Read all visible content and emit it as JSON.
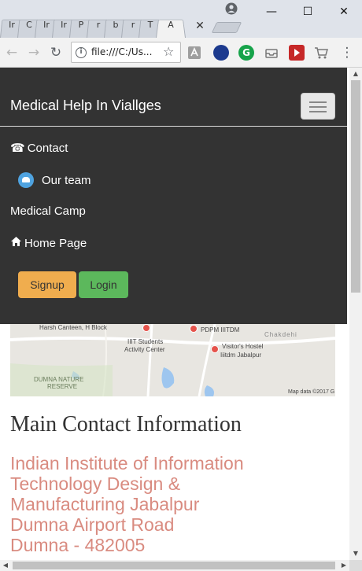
{
  "browser": {
    "tabs": [
      "Ir",
      "C",
      "Ir",
      "Ir",
      "P",
      "r",
      "b",
      "r",
      "T",
      "A"
    ],
    "url": "file:///C:/Us...",
    "window_controls": {
      "minimize": "—",
      "maximize": "☐",
      "close": "✕"
    },
    "extension_g_label": "G",
    "colors": {
      "titlebar": "#dfe3ea",
      "toolbar": "#f2f2f2"
    }
  },
  "navbar": {
    "brand": "Medical Help In Viallges",
    "items": [
      {
        "icon": "phone-icon",
        "glyph": "☎",
        "label": "Contact"
      },
      {
        "icon": "team-icon",
        "label": "Our team"
      },
      {
        "icon": "none",
        "label": "Medical Camp"
      },
      {
        "icon": "home-icon",
        "glyph": "⌂",
        "label": "Home Page"
      }
    ],
    "signup_label": "Signup",
    "login_label": "Login",
    "colors": {
      "background": "#333333",
      "signup": "#f0ad4e",
      "login": "#5cb85c"
    }
  },
  "map": {
    "labels": {
      "canteen": "Harsh Canteen, H Block",
      "pdpm": "PDPM IIITDM",
      "chakdehi": "Chakdehi",
      "activity": "IIIT Students",
      "activity2": "Activity Center",
      "hostel": "Visitor's Hostel",
      "hostel2": "Iiitdm Jabalpur",
      "reserve": "DUMNA NATURE",
      "reserve2": "RESERVE",
      "attribution": "Map data ©2017 G"
    }
  },
  "content": {
    "heading": "Main Contact Information",
    "address": [
      "Indian Institute of Information",
      "Technology Design &",
      "Manufacturing Jabalpur",
      "Dumna Airport Road",
      "Dumna - 482005"
    ],
    "address_color": "#d98b80"
  }
}
